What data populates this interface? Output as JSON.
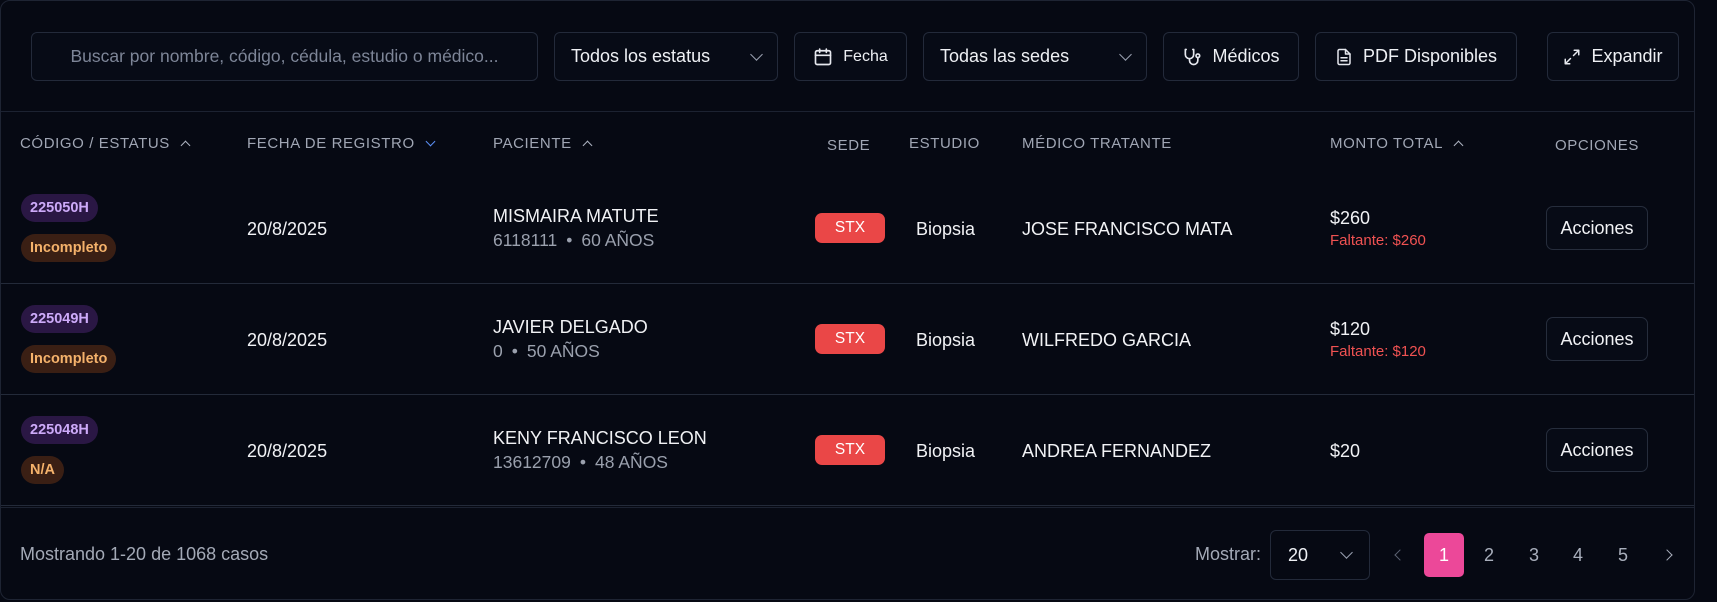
{
  "toolbar": {
    "search_placeholder": "Buscar por nombre, código, cédula, estudio o médico...",
    "status_filter": "Todos los estatus",
    "date_button": "Fecha",
    "site_filter": "Todas las sedes",
    "doctors_button": "Médicos",
    "pdf_button": "PDF Disponibles",
    "expand_button": "Expandir"
  },
  "table": {
    "headers": {
      "code_status": "CÓDIGO / ESTATUS",
      "registration_date": "FECHA DE REGISTRO",
      "patient": "PACIENTE",
      "site": "SEDE",
      "study": "ESTUDIO",
      "doctor": "MÉDICO TRATANTE",
      "total": "MONTO TOTAL",
      "options": "OPCIONES"
    },
    "rows": [
      {
        "code": "225050H",
        "status": "Incompleto",
        "date": "20/8/2025",
        "patient_name": "MISMAIRA MATUTE",
        "patient_id": "6118111",
        "patient_age": "60 AÑOS",
        "site": "STX",
        "study": "Biopsia",
        "doctor": "JOSE FRANCISCO MATA",
        "amount": "$260",
        "missing": "Faltante: $260",
        "action": "Acciones"
      },
      {
        "code": "225049H",
        "status": "Incompleto",
        "date": "20/8/2025",
        "patient_name": "JAVIER DELGADO",
        "patient_id": "0",
        "patient_age": "50 AÑOS",
        "site": "STX",
        "study": "Biopsia",
        "doctor": "WILFREDO GARCIA",
        "amount": "$120",
        "missing": "Faltante: $120",
        "action": "Acciones"
      },
      {
        "code": "225048H",
        "status": "N/A",
        "date": "20/8/2025",
        "patient_name": "KENY FRANCISCO LEON",
        "patient_id": "13612709",
        "patient_age": "48 AÑOS",
        "site": "STX",
        "study": "Biopsia",
        "doctor": "ANDREA FERNANDEZ",
        "amount": "$20",
        "missing": "",
        "action": "Acciones"
      }
    ],
    "separator": "•"
  },
  "footer": {
    "summary": "Mostrando 1-20 de 1068 casos",
    "show_label": "Mostrar:",
    "page_size": "20",
    "pages": [
      "1",
      "2",
      "3",
      "4",
      "5"
    ],
    "current_page": "1"
  },
  "colors": {
    "background": "#060913",
    "accent_pink": "#ec4899",
    "site_badge": "#ea4747",
    "code_badge_bg": "#2a1744",
    "status_badge_bg": "#3a1f14",
    "missing_amount": "#f05252",
    "sort_active": "#5b8ff6"
  },
  "icons": {
    "date_button": "calendar-icon",
    "doctors_button": "stethoscope-icon",
    "pdf_button": "document-icon",
    "expand_button": "expand-icon"
  }
}
